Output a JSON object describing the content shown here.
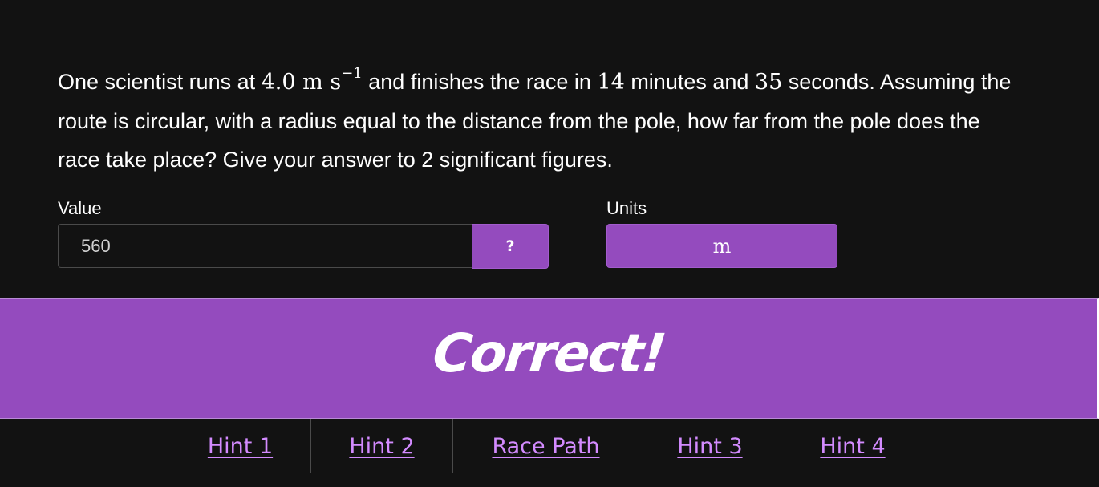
{
  "question": {
    "part1": "One scientist runs at ",
    "speed_value": "4.0",
    "speed_unit": "m s",
    "speed_exponent": "−1",
    "part2": " and finishes the race in ",
    "minutes": "14",
    "part3": " minutes and ",
    "seconds": "35",
    "part4": " seconds. Assuming the route is circular, with a radius equal to the distance from the pole, how far from the pole does the race take place? Give your answer to 2 significant figures."
  },
  "answer": {
    "value_label": "Value",
    "value": "560",
    "help_label": "?",
    "units_label": "Units",
    "units_value": "m"
  },
  "feedback": {
    "text": "Correct!"
  },
  "tabs": [
    {
      "label": "Hint 1"
    },
    {
      "label": "Hint 2"
    },
    {
      "label": "Race Path"
    },
    {
      "label": "Hint 3"
    },
    {
      "label": "Hint 4"
    }
  ],
  "colors": {
    "background": "#121212",
    "accent": "#944bbe",
    "link": "#d38bff"
  }
}
